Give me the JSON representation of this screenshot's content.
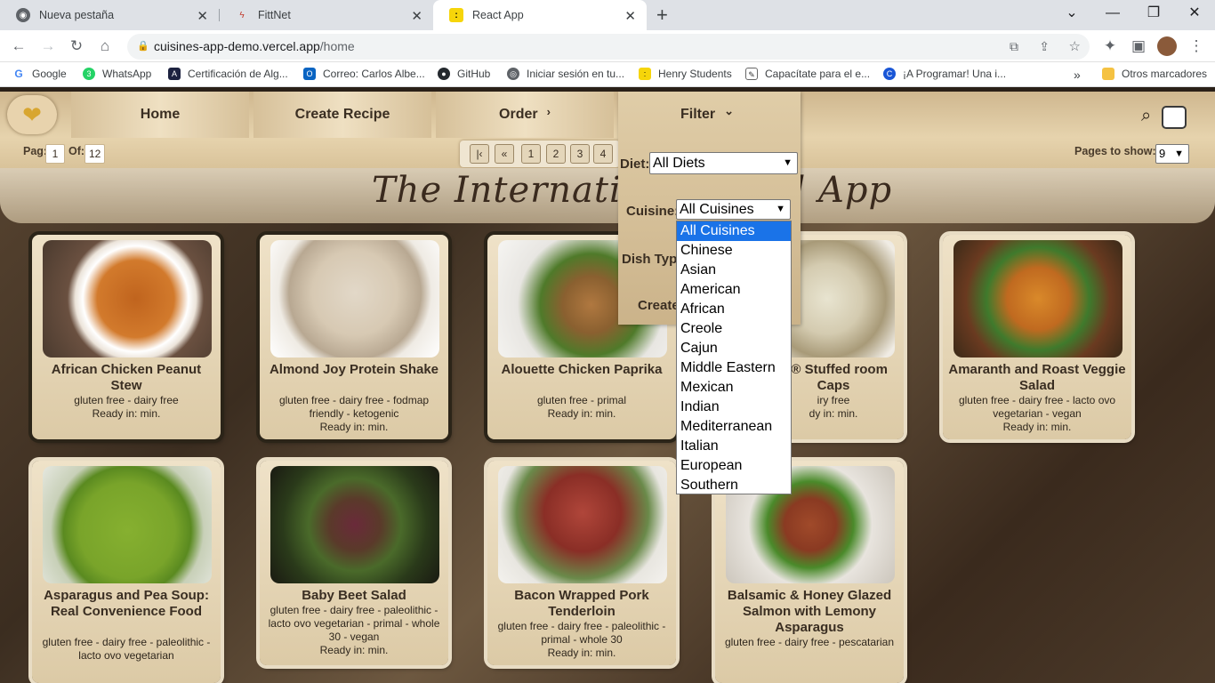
{
  "browser": {
    "tabs": [
      {
        "title": "Nueva pestaña"
      },
      {
        "title": "FittNet"
      },
      {
        "title": "React App"
      }
    ],
    "new_tab": "+",
    "url_host": "cuisines-app-demo.vercel.app",
    "url_path": "/home",
    "bookmarks": [
      {
        "label": "Google"
      },
      {
        "label": "WhatsApp"
      },
      {
        "label": "Certificación de Alg..."
      },
      {
        "label": "Correo: Carlos Albe..."
      },
      {
        "label": "GitHub"
      },
      {
        "label": "Iniciar sesión en tu..."
      },
      {
        "label": "Henry Students"
      },
      {
        "label": "Capacítate para el e..."
      },
      {
        "label": "¡A Programar! Una i..."
      }
    ],
    "more_bookmarks": "»",
    "other_bookmarks": "Otros marcadores"
  },
  "nav": {
    "home": "Home",
    "create": "Create Recipe",
    "order": "Order",
    "filter": "Filter"
  },
  "pagination": {
    "pag_label": "Pag:",
    "pag_value": "1",
    "of_label": "Of:",
    "of_value": "12",
    "pages": [
      "1",
      "2",
      "3",
      "4"
    ],
    "pages_to_show_label": "Pages to show:",
    "pages_to_show_value": "9"
  },
  "banner": {
    "title": "The International Food App"
  },
  "filter": {
    "diet_label": "Diet:",
    "diet_value": "All Diets",
    "cuisine_label": "Cuisine:",
    "cuisine_value": "All Cuisines",
    "dish_label": "Dish Typ",
    "create_label": "Create",
    "cuisine_options": [
      "All Cuisines",
      "Chinese",
      "Asian",
      "American",
      "African",
      "Creole",
      "Cajun",
      "Middle Eastern",
      "Mexican",
      "Indian",
      "Mediterranean",
      "Italian",
      "European",
      "Southern"
    ]
  },
  "recipes": [
    {
      "name": "African Chicken Peanut Stew",
      "diets": "gluten free - dairy free",
      "ready": "Ready in: min."
    },
    {
      "name": "Almond Joy Protein Shake",
      "diets": "gluten free - dairy free - fodmap friendly - ketogenic",
      "ready": "Ready in: min."
    },
    {
      "name": "Alouette Chicken Paprika",
      "diets": "gluten free - primal",
      "ready": "Ready in: min."
    },
    {
      "name": "te® Stuffed room Caps",
      "diets": "iry free",
      "ready": "dy in: min."
    },
    {
      "name": "Amaranth and Roast Veggie Salad",
      "diets": "gluten free - dairy free - lacto ovo vegetarian - vegan",
      "ready": "Ready in: min."
    },
    {
      "name": "Asparagus and Pea Soup: Real Convenience Food",
      "diets": "gluten free - dairy free - paleolithic - lacto ovo vegetarian",
      "ready": ""
    },
    {
      "name": "Baby Beet Salad",
      "diets": "gluten free - dairy free - paleolithic - lacto ovo vegetarian - primal - whole 30 - vegan",
      "ready": "Ready in: min."
    },
    {
      "name": "Bacon Wrapped Pork Tenderloin",
      "diets": "gluten free - dairy free - paleolithic - primal - whole 30",
      "ready": "Ready in: min."
    },
    {
      "name": "Balsamic & Honey Glazed Salmon with Lemony Asparagus",
      "diets": "gluten free - dairy free - pescatarian",
      "ready": ""
    }
  ],
  "colors": {
    "accent": "#1a73e8",
    "nav_bg": "#e6d3ad",
    "card_bg": "#e6d7bb"
  }
}
